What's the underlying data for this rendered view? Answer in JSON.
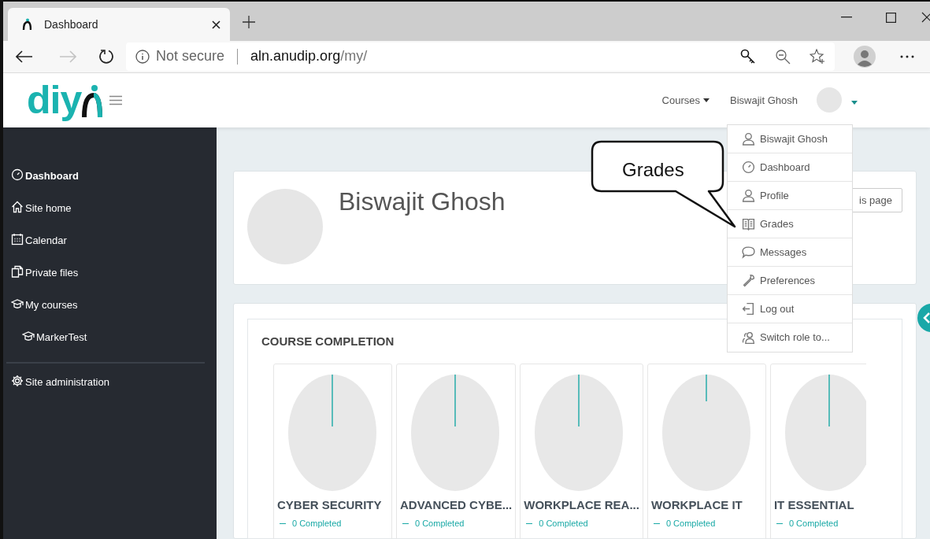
{
  "browser": {
    "tab": {
      "title": "Dashboard"
    },
    "address": {
      "security": "Not secure",
      "host": "aln.anudip.org",
      "path": "/my/"
    }
  },
  "header": {
    "logo": "diy",
    "nav": [
      {
        "label": "Courses",
        "kind": "dropdown"
      },
      {
        "label": "Biswajit Ghosh",
        "kind": "text"
      }
    ]
  },
  "sidebar": {
    "items": [
      {
        "label": "Dashboard",
        "kind": "gauge",
        "selected": true
      },
      {
        "label": "Site home",
        "kind": "home",
        "selected": false
      },
      {
        "label": "Calendar",
        "kind": "calendar",
        "selected": false
      },
      {
        "label": "Private files",
        "kind": "files",
        "selected": false
      },
      {
        "label": "My courses",
        "kind": "cap",
        "selected": false,
        "children": [
          {
            "label": "MarkerTest",
            "kind": "cap",
            "selected": false
          }
        ]
      }
    ],
    "admin_items": [
      {
        "label": "Site administration",
        "kind": "gear",
        "selected": false
      }
    ]
  },
  "profile": {
    "name": "Biswajit Ghosh",
    "button": "is page"
  },
  "course_completion": {
    "title": "COURSE COMPLETION",
    "courses": [
      {
        "name": "CYBER SECURITY",
        "status": "0 Completed"
      },
      {
        "name": "ADVANCED CYBE...",
        "status": "0 Completed"
      },
      {
        "name": "WORKPLACE REA...",
        "status": "0 Completed"
      },
      {
        "name": "WORKPLACE IT",
        "status": "0 Completed"
      },
      {
        "name": "IT ESSENTIAL",
        "status": "0 Completed"
      }
    ]
  },
  "user_menu": {
    "items": [
      {
        "label": "Biswajit Ghosh",
        "kind": "user"
      },
      {
        "label": "Dashboard",
        "kind": "gauge"
      },
      {
        "label": "Profile",
        "kind": "user"
      },
      {
        "label": "Grades",
        "kind": "book"
      },
      {
        "label": "Messages",
        "kind": "chat"
      },
      {
        "label": "Preferences",
        "kind": "wrench"
      },
      {
        "label": "Log out",
        "kind": "logout"
      },
      {
        "label": "Switch role to...",
        "kind": "users"
      }
    ]
  },
  "callout": {
    "text": "Grades"
  }
}
